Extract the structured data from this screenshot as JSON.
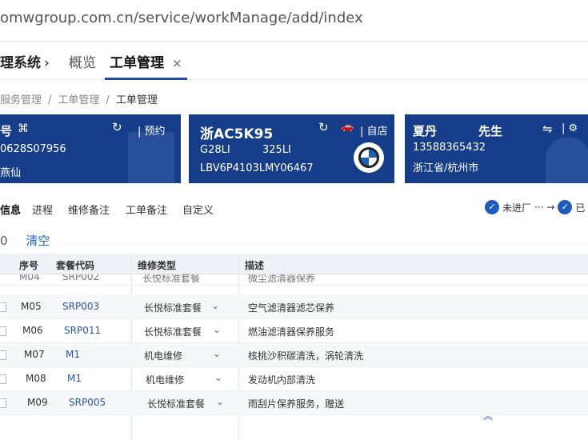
{
  "browser": {
    "url": "omwgroup.com.cn/service/workManage/add/index"
  },
  "topnav": {
    "brand": "理系统",
    "brand_chevron": "›",
    "tabs": [
      {
        "label": "概览"
      },
      {
        "label": "工单管理",
        "close": "×"
      }
    ]
  },
  "breadcrumb": {
    "items": [
      "服务管理",
      "工单管理",
      "工单管理"
    ],
    "separator": "/"
  },
  "cards": {
    "order": {
      "title": "号",
      "refresh_icon": "↻",
      "link": "预约",
      "number": "0628S07956",
      "name": "燕仙"
    },
    "vehicle": {
      "plate": "浙AC5K95",
      "refresh_icon": "↻",
      "link": "自店",
      "model": "G28LI",
      "variant": "325LI",
      "vin": "LBV6P4103LMY06467"
    },
    "customer": {
      "name": "夏丹",
      "title": "先生",
      "swap_icon": "⇋",
      "phone": "13588365432",
      "region": "浙江省/杭州市"
    }
  },
  "subtabs": [
    "信息",
    "进程",
    "维修备注",
    "工单备注",
    "自定义"
  ],
  "status": {
    "step1": "未进厂",
    "connector": "··· →",
    "step2": "已"
  },
  "actions": {
    "count": "0",
    "clear": "清空"
  },
  "table": {
    "headers": [
      "序号",
      "套餐代码",
      "维修类型",
      "描述"
    ],
    "partial_row": {
      "seq": "M04",
      "code": "SRP002",
      "type": "长悦标准套餐",
      "desc": "微尘滤清器保养"
    },
    "rows": [
      {
        "seq": "M05",
        "code": "SRP003",
        "type": "长悦标准套餐",
        "desc": "空气滤清器滤芯保养"
      },
      {
        "seq": "M06",
        "code": "SRP011",
        "type": "长悦标准套餐",
        "desc": "燃油滤清器保养服务"
      },
      {
        "seq": "M07",
        "code": "M1",
        "type": "机电维修",
        "desc": "核桃沙积碳清洗，涡轮清洗"
      },
      {
        "seq": "M08",
        "code": "M1",
        "type": "机电维修",
        "desc": "发动机内部清洗"
      },
      {
        "seq": "M09",
        "code": "SRP005",
        "type": "长悦标准套餐",
        "desc": "雨刮片保养服务，赠送"
      }
    ]
  }
}
